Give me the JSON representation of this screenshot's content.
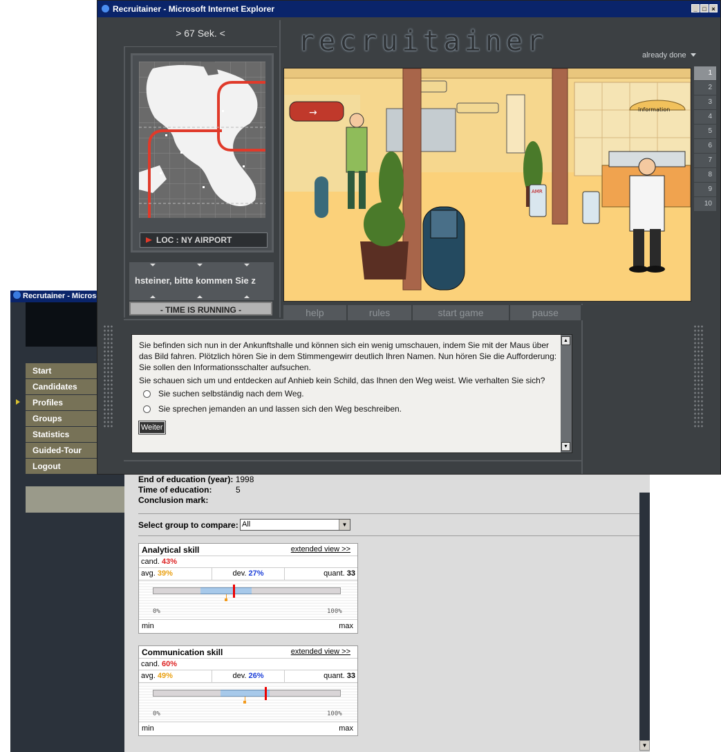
{
  "bg_window": {
    "title": "Recrutainer - Microsoft Internet Explorer",
    "menu": [
      "Start",
      "Candidates",
      "Profiles",
      "Groups",
      "Statistics",
      "Guided-Tour",
      "Logout"
    ],
    "active_menu": "Candidates",
    "info": {
      "end_label": "End of education (year):",
      "end_value": "1998",
      "time_label": "Time of education:",
      "time_value": "5",
      "mark_label": "Conclusion mark:"
    },
    "compare_label": "Select group to compare:",
    "compare_value": "All",
    "skills": [
      {
        "name": "Analytical skill",
        "link": "extended view >>",
        "cand_label": "cand.",
        "cand": "43%",
        "avg_label": "avg.",
        "avg": "39%",
        "dev_label": "dev.",
        "dev": "27%",
        "quant_label": "quant.",
        "quant": "33",
        "scale_min": "0%",
        "scale_max": "100%",
        "min_label": "min",
        "max_label": "max",
        "cand_value": 0.43,
        "avg_value": 0.39,
        "dev_value": 0.27
      },
      {
        "name": "Communication skill",
        "link": "extended view >>",
        "cand_label": "cand.",
        "cand": "60%",
        "avg_label": "avg.",
        "avg": "49%",
        "dev_label": "dev.",
        "dev": "26%",
        "quant_label": "quant.",
        "quant": "33",
        "scale_min": "0%",
        "scale_max": "100%",
        "min_label": "min",
        "max_label": "max",
        "cand_value": 0.6,
        "avg_value": 0.49,
        "dev_value": 0.26
      }
    ]
  },
  "game": {
    "title": "Recruitainer - Microsoft Internet Explorer",
    "timer": "> 67 Sek. <",
    "logo": "recruitainer",
    "already_done": "already done",
    "location": "LOC : NY AIRPORT",
    "ticker": "hsteiner, bitte kommen Sie z",
    "status": "- TIME IS RUNNING -",
    "levels": [
      "1",
      "2",
      "3",
      "4",
      "5",
      "6",
      "7",
      "8",
      "9",
      "10"
    ],
    "active_level": "1",
    "nav": [
      "help",
      "rules",
      "start game",
      "pause"
    ],
    "scene_sign_info": "Information",
    "scene_sign_amr": "AMR",
    "paragraph1": "Sie befinden sich nun in der Ankunftshalle und können sich ein wenig umschauen, indem Sie mit der Maus über das Bild fahren. Plötzlich hören Sie in dem Stimmengewirr deutlich Ihren Namen. Nun hören Sie die Aufforderung: Sie sollen den Informationsschalter aufsuchen.",
    "paragraph2": "Sie schauen sich um und entdecken auf Anhieb kein Schild, das Ihnen den Weg weist. Wie verhalten Sie sich?",
    "options": [
      "Sie suchen selbständig nach dem Weg.",
      "Sie sprechen jemanden an und lassen sich den Weg beschreiben."
    ],
    "weiter": "Weiter",
    "colors": {
      "titlebar": "#0a246a",
      "chrome": "#3c4043",
      "menu": "#777257",
      "cand": "#dd2222",
      "avg": "#e9a012",
      "dev": "#1a3dd8"
    }
  }
}
